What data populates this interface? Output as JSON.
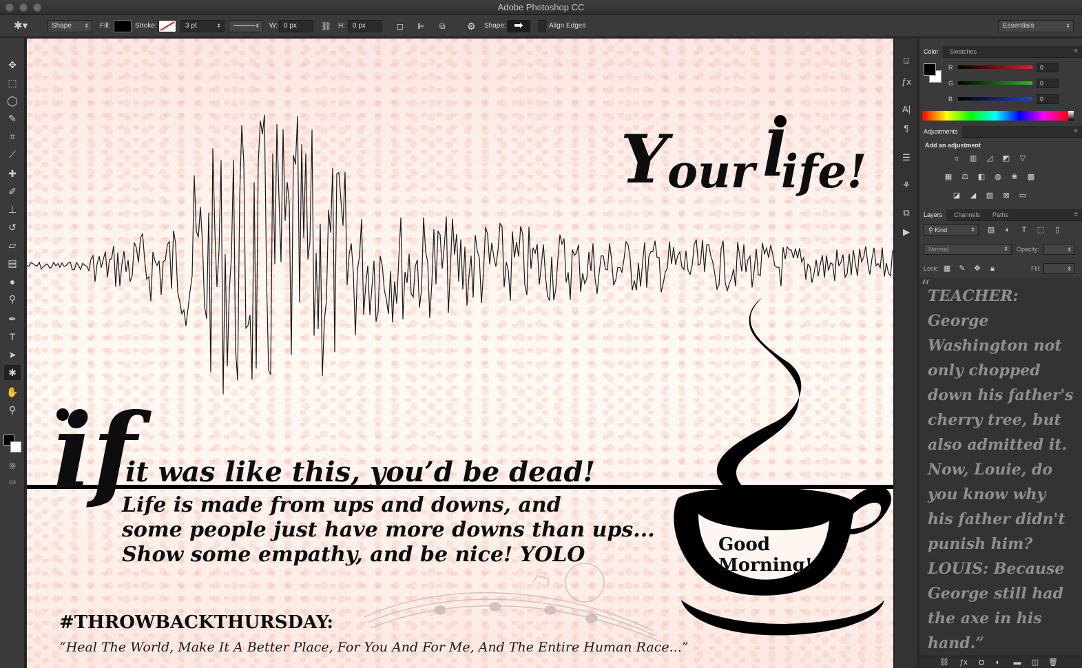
{
  "app": {
    "title": "Adobe Photoshop CC",
    "workspace": "Essentials"
  },
  "options": {
    "tool_mode": "Shape",
    "fill_label": "Fill:",
    "stroke_label": "Stroke:",
    "stroke_width": "3 pt",
    "w_label": "W:",
    "w_value": "0 px",
    "h_label": "H:",
    "h_value": "0 px",
    "shape_label": "Shape:",
    "align_edges": "Align Edges"
  },
  "tools": [
    "move-icon",
    "marquee-icon",
    "lasso-icon",
    "quick-select-icon",
    "crop-icon",
    "eyedropper-icon",
    "healing-icon",
    "brush-icon",
    "stamp-icon",
    "history-brush-icon",
    "eraser-icon",
    "gradient-icon",
    "blur-icon",
    "dodge-icon",
    "pen-icon",
    "type-icon",
    "path-select-icon",
    "custom-shape-icon",
    "hand-icon",
    "zoom-icon"
  ],
  "color_panel": {
    "tabs": [
      "Color",
      "Swatches"
    ],
    "channels": [
      {
        "label": "R",
        "value": "0",
        "color": "#e02020"
      },
      {
        "label": "G",
        "value": "0",
        "color": "#20c020"
      },
      {
        "label": "B",
        "value": "0",
        "color": "#2040e0"
      }
    ]
  },
  "adjustments_panel": {
    "tab": "Adjustments",
    "heading": "Add an adjustment"
  },
  "layers_panel": {
    "tabs": [
      "Layers",
      "Channels",
      "Paths"
    ],
    "kind": "Kind",
    "blend_mode": "Normal",
    "opacity_label": "Opacity:",
    "lock_label": "Lock:",
    "fill_label": "Fill:"
  },
  "overlay_quote": {
    "open_mark": "“",
    "lines": [
      "TEACHER:",
      "George",
      "Washington not",
      "only chopped",
      "down his father's",
      "cherry tree, but",
      "also admitted it.",
      "Now, Louie, do",
      "you know why",
      "his father didn't",
      "punish him?",
      "LOUIS: Because",
      "George still had",
      "the axe in his",
      "hand.”"
    ]
  },
  "poster": {
    "your_life_y": "Y",
    "your_life_rest1": "our ",
    "your_life_l": "l",
    "your_life_rest2": "ife!",
    "big_if": "if",
    "line1": "it was like this, you’d be dead!",
    "line2": "Life is made from ups and downs, and",
    "line3": "some people just have more downs than ups...",
    "line4": "Show some empathy, and be nice! YOLO",
    "good": "Good",
    "morning": "Morning!",
    "hashtag": "#THROWBACKTHURSDAY:",
    "lyric": "“Heal The World, Make It A Better Place, For You And For Me, And The Entire Human Race...”"
  }
}
